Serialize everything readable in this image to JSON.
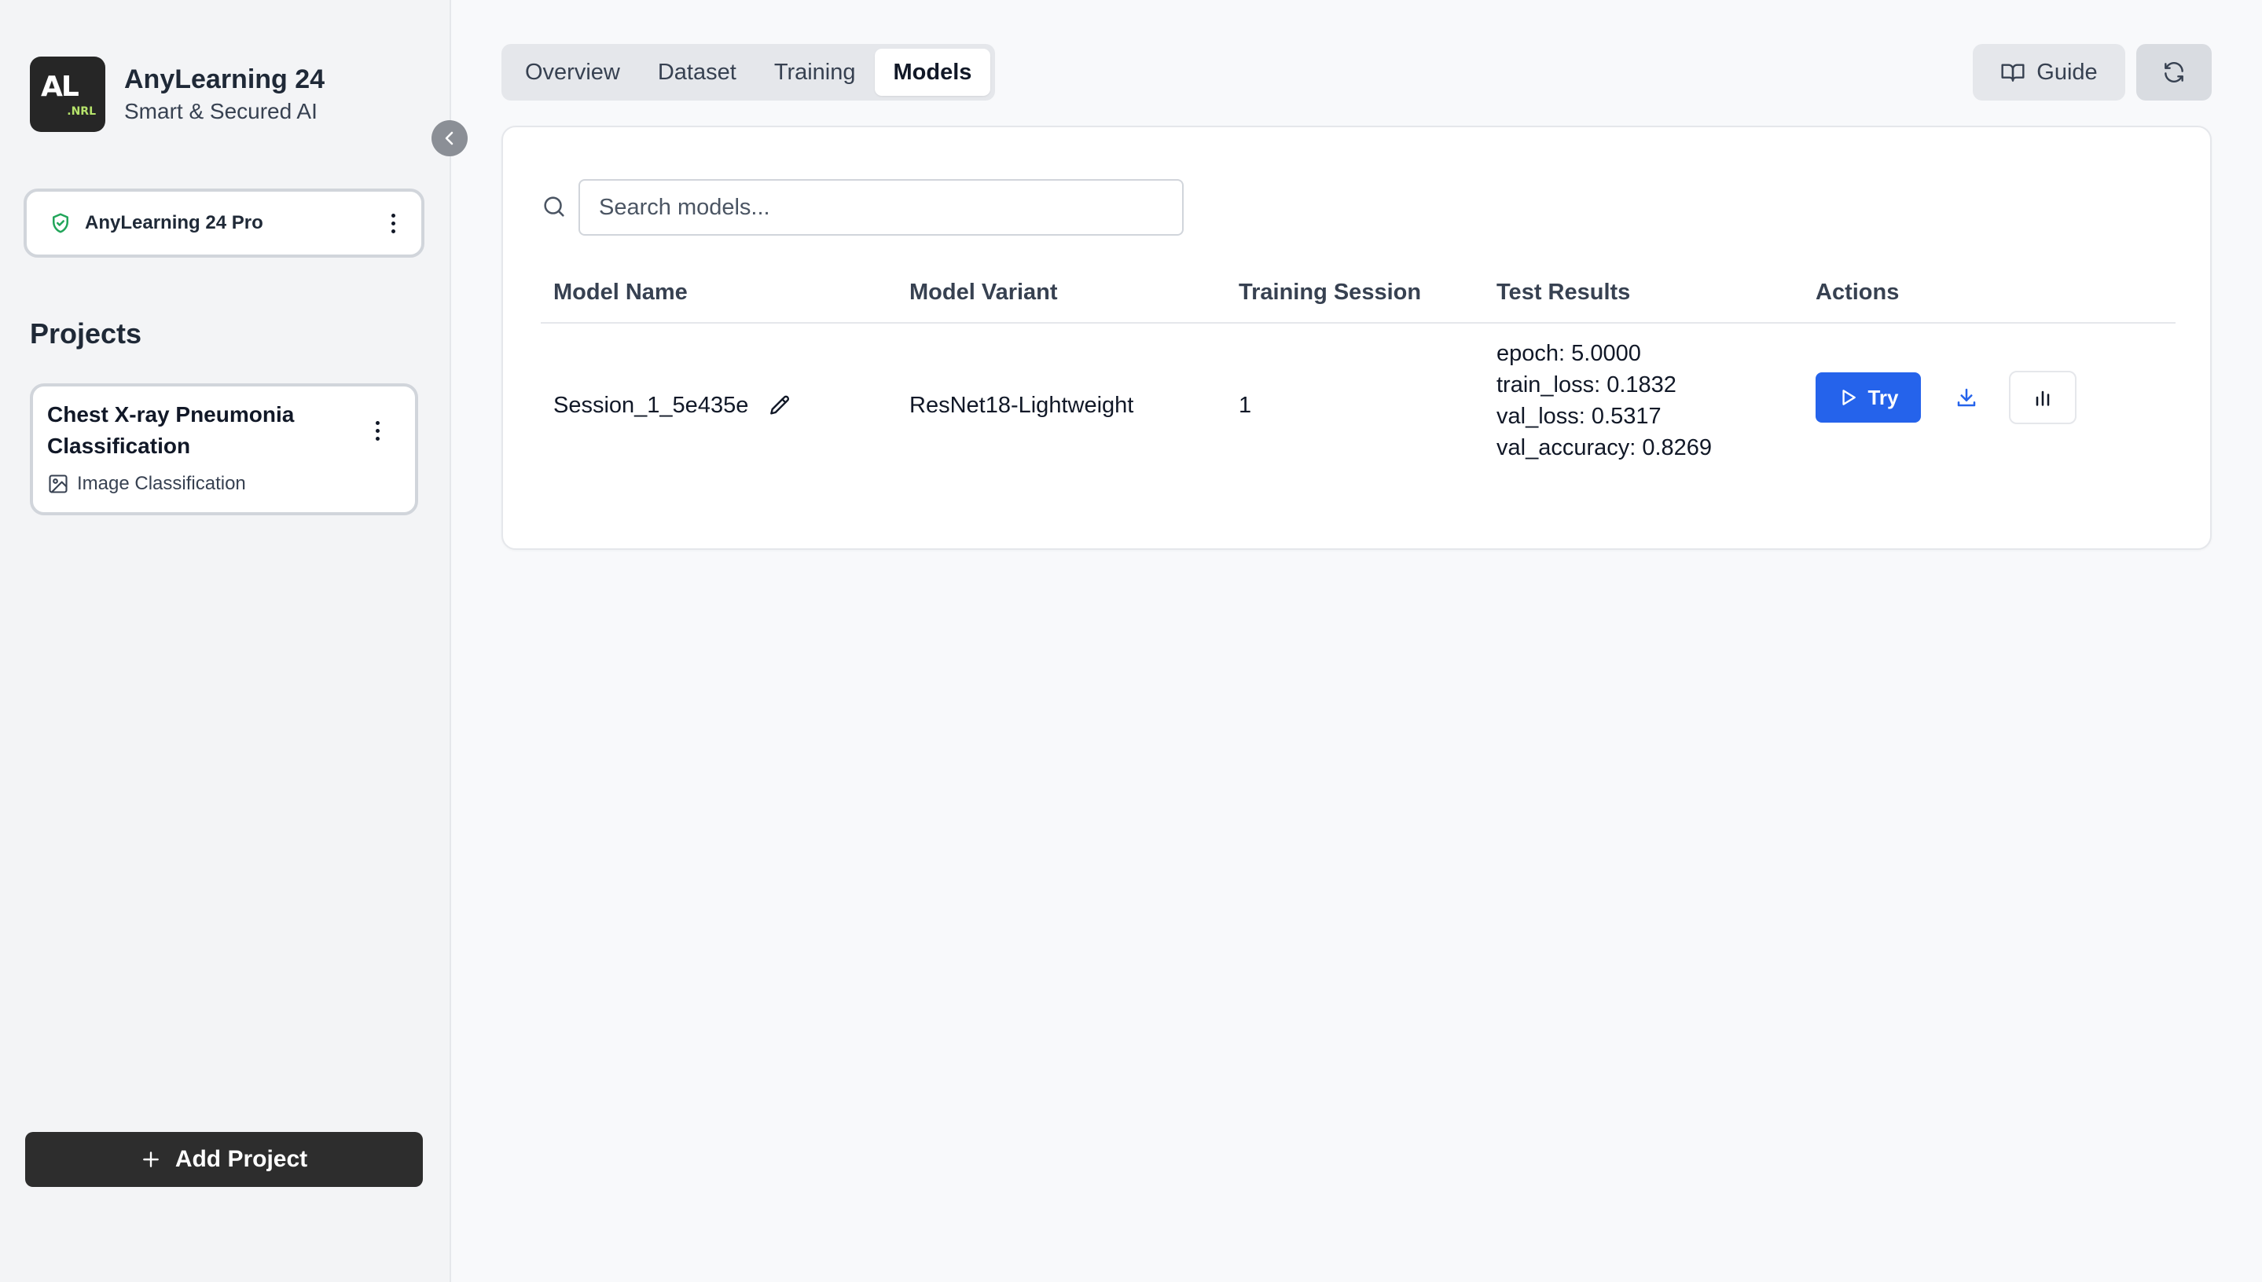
{
  "brand": {
    "logo_text": "AL",
    "logo_subtext": ".NRL",
    "title": "AnyLearning 24",
    "subtitle": "Smart & Secured AI"
  },
  "license": {
    "label": "AnyLearning 24 Pro"
  },
  "projects": {
    "title": "Projects",
    "items": [
      {
        "name": "Chest X-ray Pneumonia Classification",
        "type": "Image Classification"
      }
    ],
    "add_label": "Add Project"
  },
  "tabs": [
    {
      "label": "Overview",
      "active": false
    },
    {
      "label": "Dataset",
      "active": false
    },
    {
      "label": "Training",
      "active": false
    },
    {
      "label": "Models",
      "active": true
    }
  ],
  "toolbar": {
    "guide_label": "Guide"
  },
  "search": {
    "placeholder": "Search models..."
  },
  "table": {
    "headers": [
      "Model Name",
      "Model Variant",
      "Training Session",
      "Test Results",
      "Actions"
    ],
    "rows": [
      {
        "model_name": "Session_1_5e435e",
        "variant": "ResNet18-Lightweight",
        "session": "1",
        "results": [
          "epoch: 5.0000",
          "train_loss: 0.1832",
          "val_loss: 0.5317",
          "val_accuracy: 0.8269"
        ],
        "try_label": "Try"
      }
    ]
  },
  "colors": {
    "accent": "#2563eb",
    "shield": "#22a55a",
    "dark_button": "#2d2d2d"
  }
}
